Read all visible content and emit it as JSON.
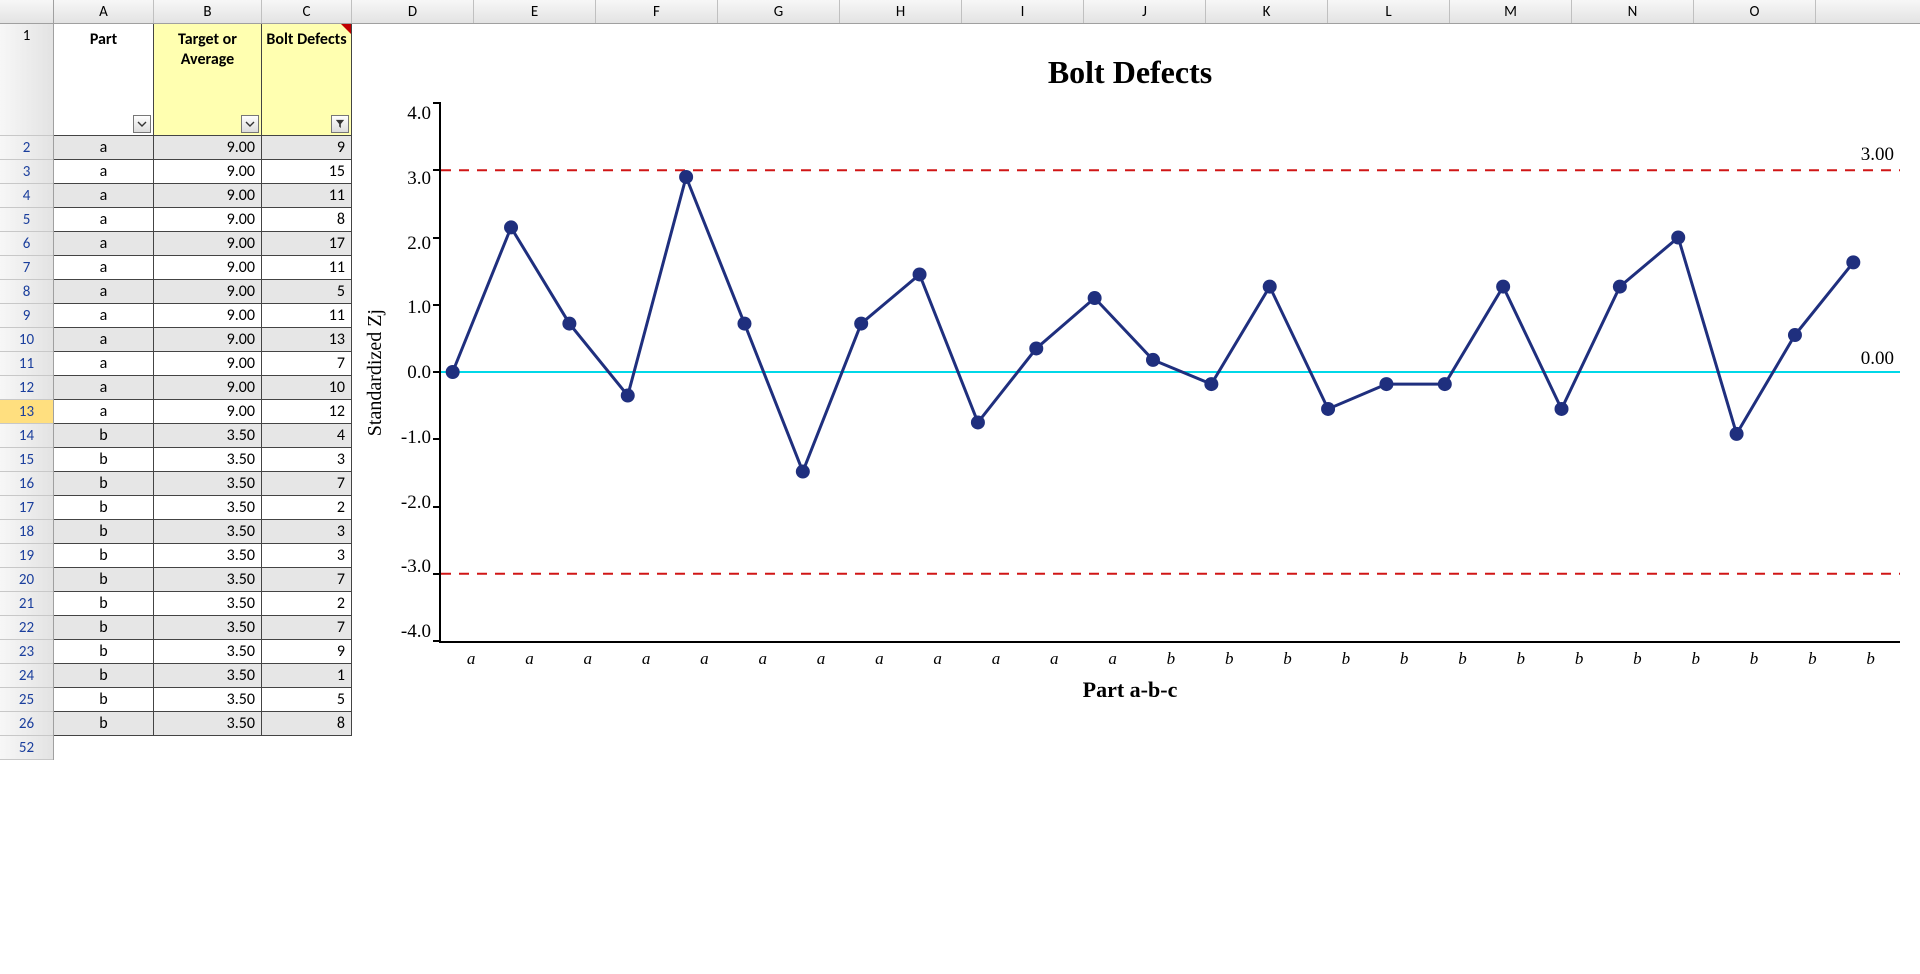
{
  "columns": [
    "A",
    "B",
    "C",
    "D",
    "E",
    "F",
    "G",
    "H",
    "I",
    "J",
    "K",
    "L",
    "M",
    "N",
    "O"
  ],
  "headers": {
    "A": "Part",
    "B": "Target or Average",
    "C": "Bolt Defects"
  },
  "selected_row": 13,
  "rows": [
    {
      "n": 2,
      "part": "a",
      "avg": "9.00",
      "def": "9"
    },
    {
      "n": 3,
      "part": "a",
      "avg": "9.00",
      "def": "15"
    },
    {
      "n": 4,
      "part": "a",
      "avg": "9.00",
      "def": "11"
    },
    {
      "n": 5,
      "part": "a",
      "avg": "9.00",
      "def": "8"
    },
    {
      "n": 6,
      "part": "a",
      "avg": "9.00",
      "def": "17"
    },
    {
      "n": 7,
      "part": "a",
      "avg": "9.00",
      "def": "11"
    },
    {
      "n": 8,
      "part": "a",
      "avg": "9.00",
      "def": "5"
    },
    {
      "n": 9,
      "part": "a",
      "avg": "9.00",
      "def": "11"
    },
    {
      "n": 10,
      "part": "a",
      "avg": "9.00",
      "def": "13"
    },
    {
      "n": 11,
      "part": "a",
      "avg": "9.00",
      "def": "7"
    },
    {
      "n": 12,
      "part": "a",
      "avg": "9.00",
      "def": "10"
    },
    {
      "n": 13,
      "part": "a",
      "avg": "9.00",
      "def": "12"
    },
    {
      "n": 14,
      "part": "b",
      "avg": "3.50",
      "def": "4"
    },
    {
      "n": 15,
      "part": "b",
      "avg": "3.50",
      "def": "3"
    },
    {
      "n": 16,
      "part": "b",
      "avg": "3.50",
      "def": "7"
    },
    {
      "n": 17,
      "part": "b",
      "avg": "3.50",
      "def": "2"
    },
    {
      "n": 18,
      "part": "b",
      "avg": "3.50",
      "def": "3"
    },
    {
      "n": 19,
      "part": "b",
      "avg": "3.50",
      "def": "3"
    },
    {
      "n": 20,
      "part": "b",
      "avg": "3.50",
      "def": "7"
    },
    {
      "n": 21,
      "part": "b",
      "avg": "3.50",
      "def": "2"
    },
    {
      "n": 22,
      "part": "b",
      "avg": "3.50",
      "def": "7"
    },
    {
      "n": 23,
      "part": "b",
      "avg": "3.50",
      "def": "9"
    },
    {
      "n": 24,
      "part": "b",
      "avg": "3.50",
      "def": "1"
    },
    {
      "n": 25,
      "part": "b",
      "avg": "3.50",
      "def": "5"
    },
    {
      "n": 26,
      "part": "b",
      "avg": "3.50",
      "def": "8"
    }
  ],
  "extra_row_num": "52",
  "chart_data": {
    "type": "line",
    "title": "Bolt Defects",
    "ylabel": "Standardized  Zj",
    "xlabel": "Part a-b-c",
    "ylim": [
      -4,
      4
    ],
    "yticks": [
      "4.0",
      "3.0",
      "2.0",
      "1.0",
      "0.0",
      "-1.0",
      "-2.0",
      "-3.0",
      "-4.0"
    ],
    "ucl": 3.0,
    "ucl_label": "3.00",
    "center": 0.0,
    "center_label": "0.00",
    "lcl": -3.0,
    "categories": [
      "a",
      "a",
      "a",
      "a",
      "a",
      "a",
      "a",
      "a",
      "a",
      "a",
      "a",
      "a",
      "b",
      "b",
      "b",
      "b",
      "b",
      "b",
      "b",
      "b",
      "b",
      "b",
      "b",
      "b",
      "b"
    ],
    "values": [
      0.0,
      2.15,
      0.72,
      -0.35,
      2.9,
      0.72,
      -1.48,
      0.72,
      1.45,
      -0.75,
      0.35,
      1.1,
      0.18,
      -0.18,
      1.27,
      -0.55,
      -0.18,
      -0.18,
      1.27,
      -0.55,
      1.27,
      2.0,
      -0.92,
      0.55,
      1.63
    ],
    "colors": {
      "series": "#1f2f7e",
      "limit": "#d01616",
      "center": "#00d8e8"
    }
  }
}
